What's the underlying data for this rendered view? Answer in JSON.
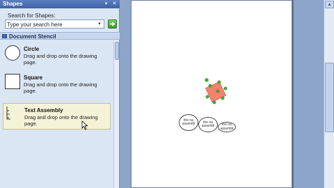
{
  "pane": {
    "title": "Shapes",
    "search_label": "Search for Shapes:",
    "search_placeholder": "Type your search here",
    "stencil_title": "Document Stencil",
    "masters": [
      {
        "name": "Circle",
        "desc": "Drag and drop onto the drawing page."
      },
      {
        "name": "Square",
        "desc": "Drag and drop onto the drawing page."
      },
      {
        "name": "Text Assembly",
        "desc": "Drag and drop onto the drawing page."
      }
    ]
  },
  "drawing": {
    "bubbles": [
      {
        "text": "the na assembl"
      },
      {
        "text": "the na assembl"
      },
      {
        "text": "the na assembl"
      }
    ],
    "selected_shape_color": "#f0826e",
    "handle_color": "#3fae3a"
  }
}
